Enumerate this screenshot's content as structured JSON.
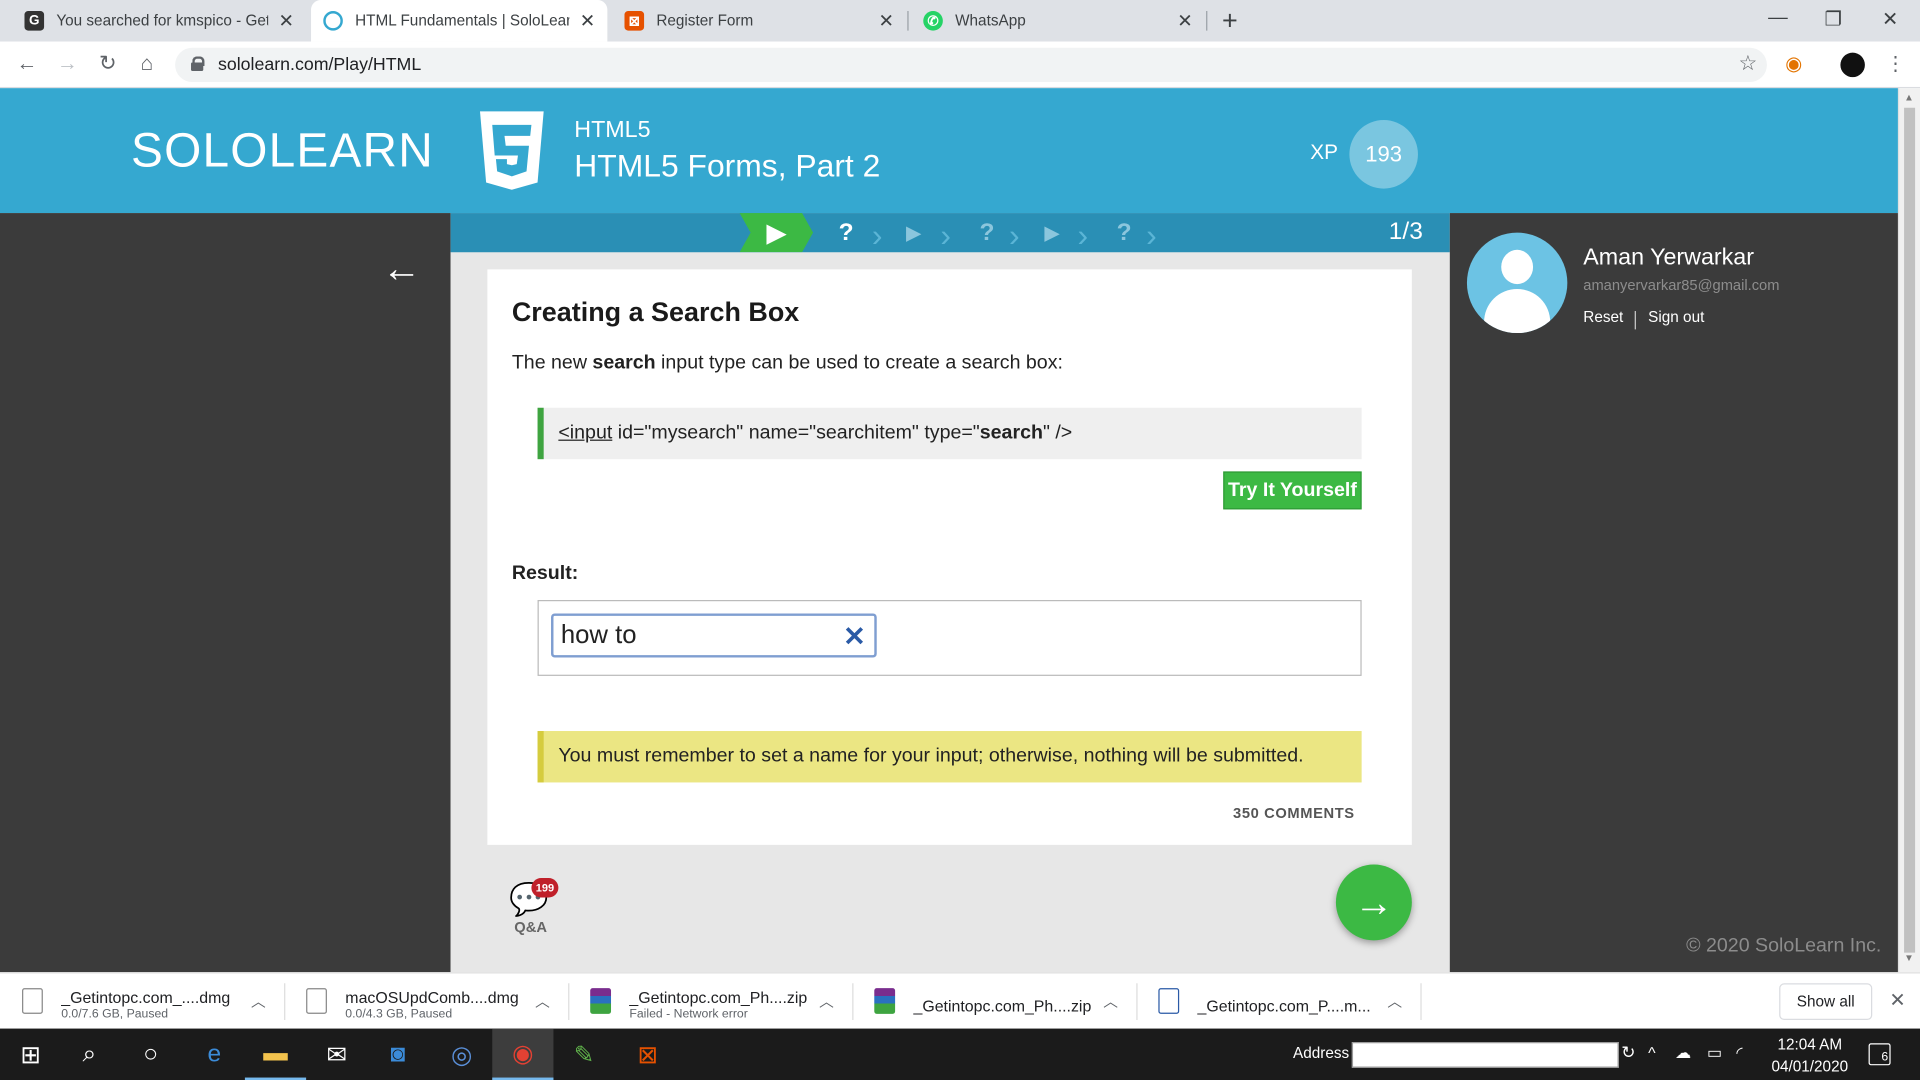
{
  "browser": {
    "tabs": [
      {
        "title": "You searched for kmspico - Get I",
        "favicon": "G",
        "color": "#333333"
      },
      {
        "title": "HTML Fundamentals | SoloLearn:",
        "favicon": "S",
        "color": "#35a8d0"
      },
      {
        "title": "Register Form",
        "favicon": "R",
        "color": "#e65100"
      },
      {
        "title": "WhatsApp",
        "favicon": "W",
        "color": "#25d366"
      }
    ],
    "url": "sololearn.com/Play/HTML"
  },
  "header": {
    "logo": "SOLOLEARN",
    "course": "HTML5",
    "lesson": "HTML5 Forms, Part 2",
    "xp_label": "XP",
    "xp_value": "193"
  },
  "progress": {
    "count": "1/3"
  },
  "lesson": {
    "title": "Creating a Search Box",
    "intro_before": "The new ",
    "intro_bold": "search",
    "intro_after": " input type can be used to create a search box:",
    "code_tag": "<input",
    "code_mid": " id=\"mysearch\" name=\"searchitem\" type=\"",
    "code_bold": "search",
    "code_end": "\" />",
    "try_label": "Try It Yourself",
    "result_label": "Result:",
    "search_value": "how to",
    "note": "You must remember to set a name for your input; otherwise, nothing will be submitted.",
    "comments": "350 COMMENTS",
    "qa_count": "199",
    "qa_label": "Q&A"
  },
  "user": {
    "name": "Aman Yerwarkar",
    "email": "amanyervarkar85@gmail.com",
    "reset": "Reset",
    "signout": "Sign out",
    "copyright": "© 2020 SoloLearn Inc."
  },
  "downloads": [
    {
      "name": "_Getintopc.com_....dmg",
      "status": "0.0/7.6 GB, Paused"
    },
    {
      "name": "macOSUpdComb....dmg",
      "status": "0.0/4.3 GB, Paused"
    },
    {
      "name": "_Getintopc.com_Ph....zip",
      "status": "Failed - Network error"
    },
    {
      "name": "_Getintopc.com_Ph....zip",
      "status": ""
    },
    {
      "name": "_Getintopc.com_P....m...",
      "status": ""
    }
  ],
  "downloads_showall": "Show all",
  "taskbar": {
    "address_label": "Address",
    "time": "12:04 AM",
    "date": "04/01/2020",
    "notifications": "6"
  }
}
